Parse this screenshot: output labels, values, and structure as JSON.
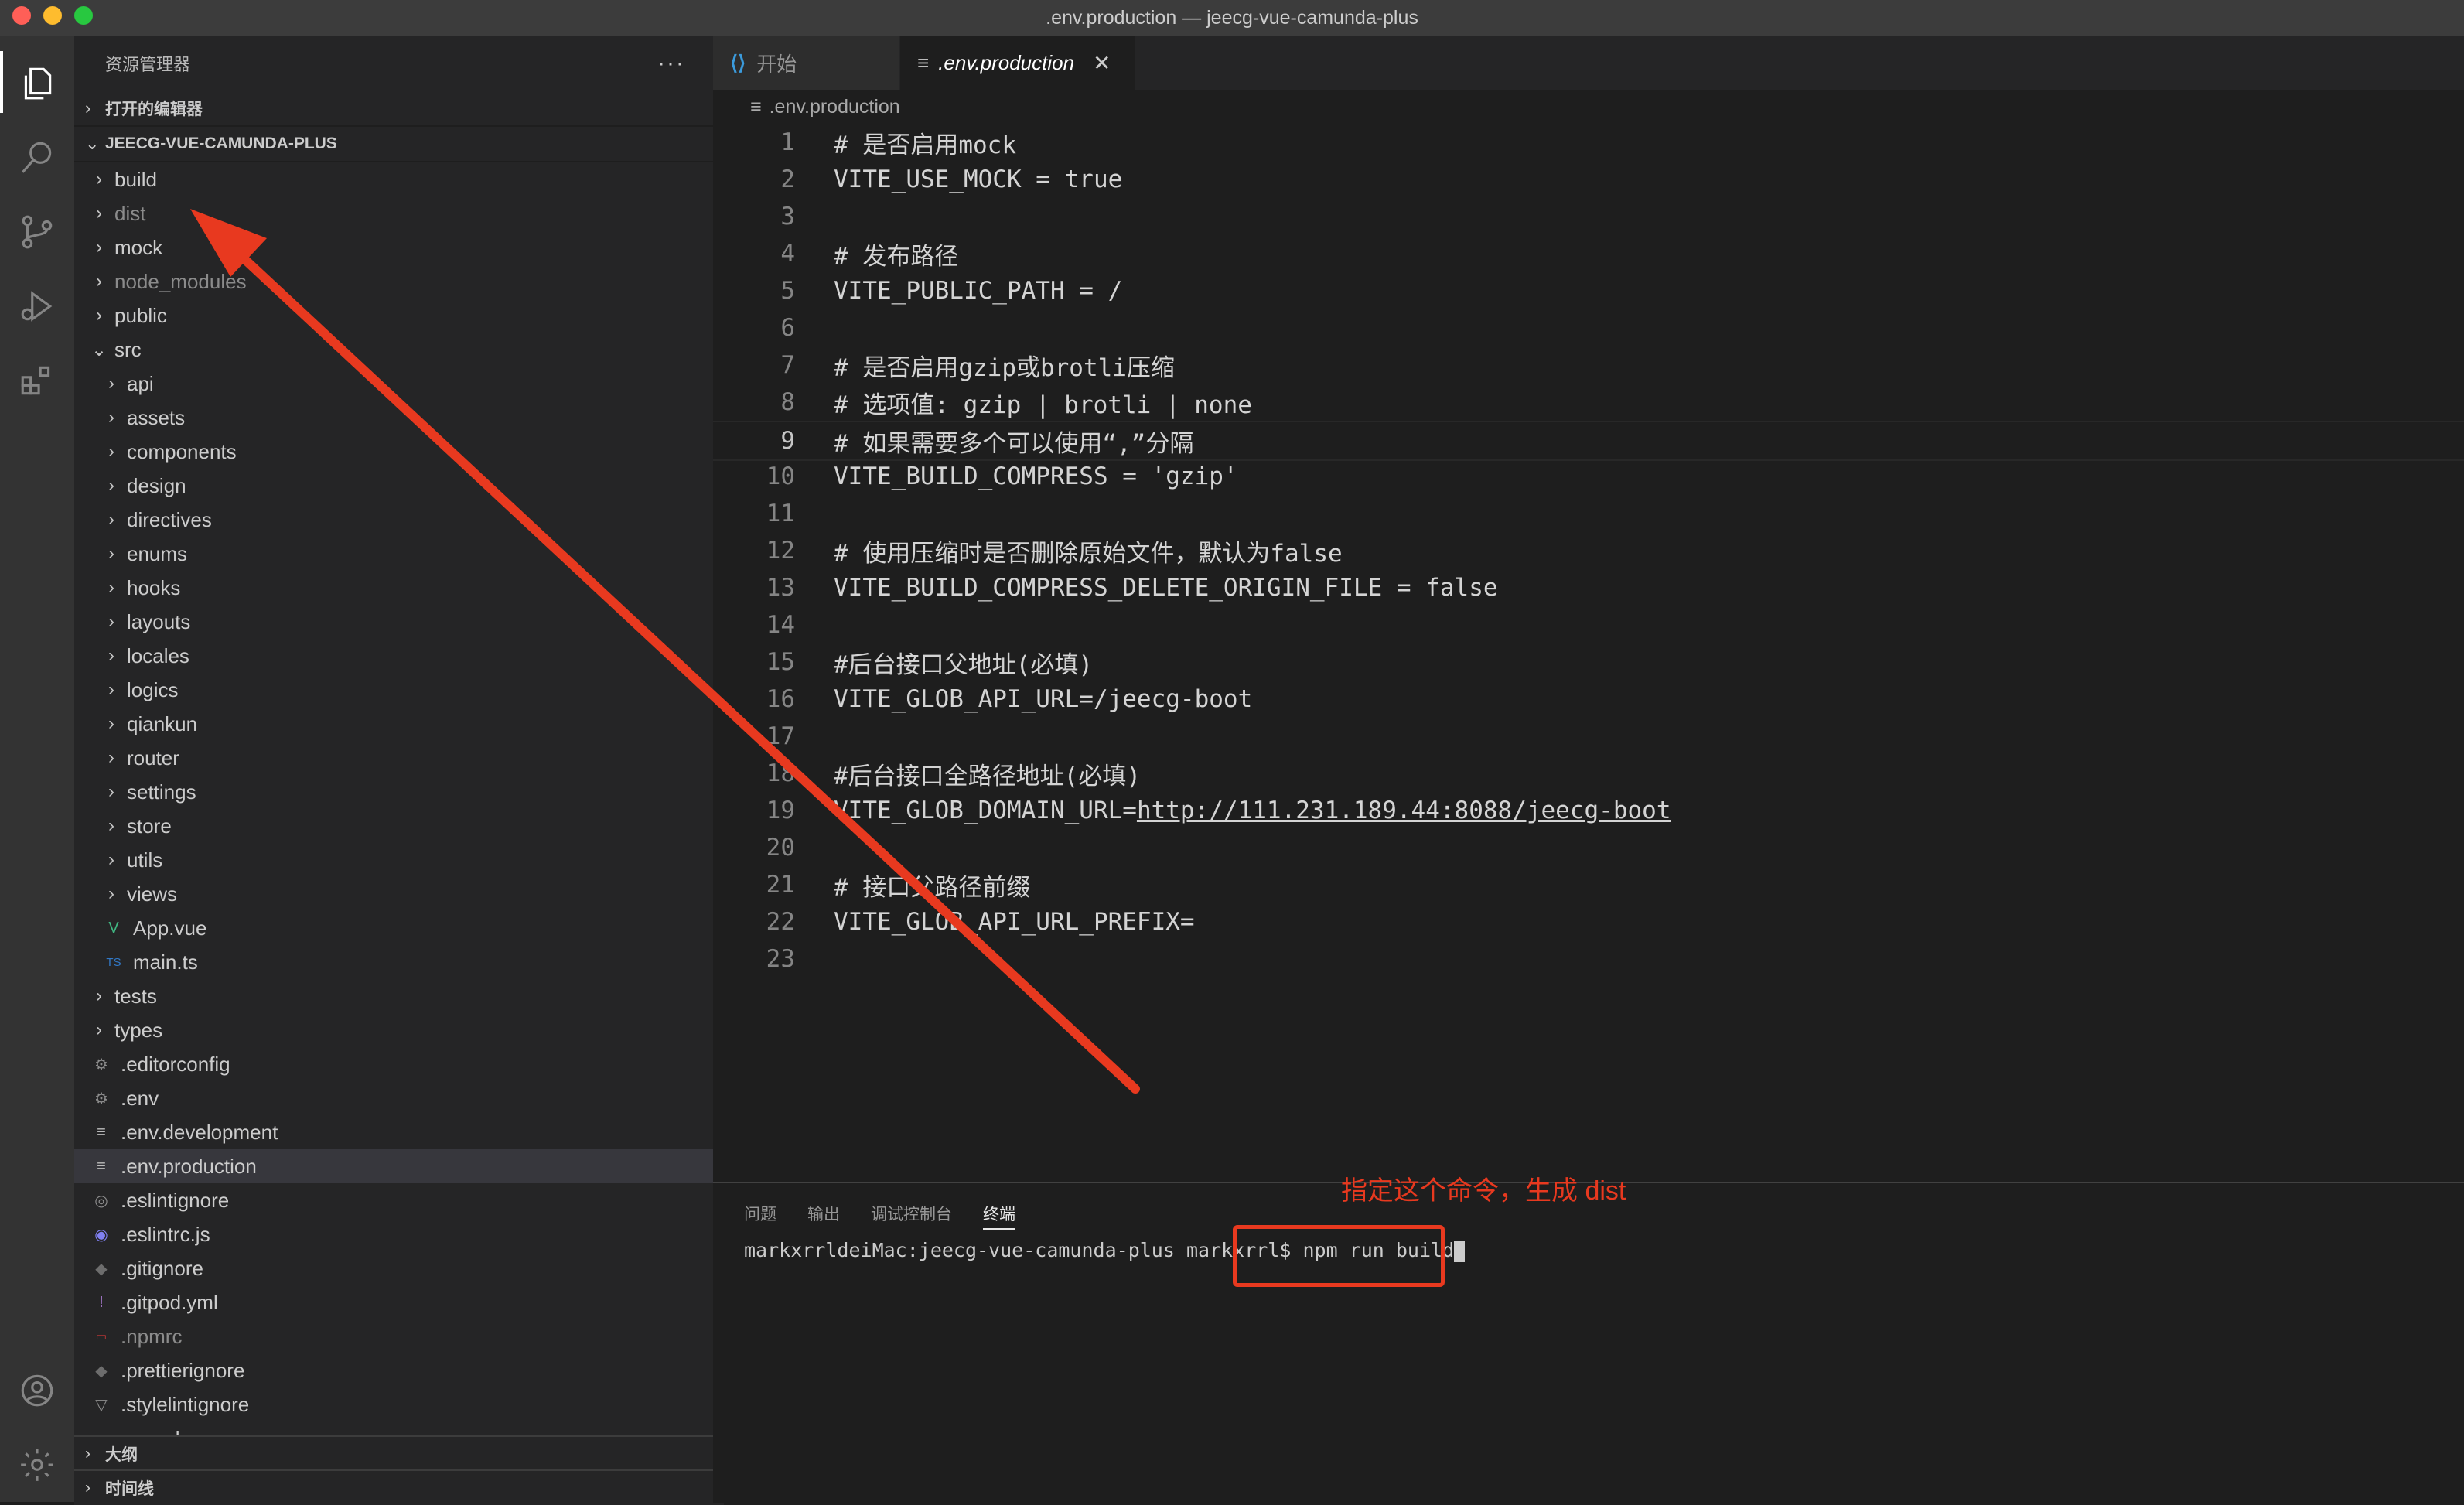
{
  "window": {
    "title": ".env.production — jeecg-vue-camunda-plus"
  },
  "sidebar": {
    "title": "资源管理器",
    "open_editors": "打开的编辑器",
    "project": "JEECG-VUE-CAMUNDA-PLUS",
    "outline": "大纲",
    "timeline": "时间线"
  },
  "explorer": {
    "items": [
      {
        "label": "build",
        "type": "folder",
        "depth": 1
      },
      {
        "label": "dist",
        "type": "folder",
        "depth": 1,
        "dim": true
      },
      {
        "label": "mock",
        "type": "folder",
        "depth": 1
      },
      {
        "label": "node_modules",
        "type": "folder",
        "depth": 1,
        "dim": true
      },
      {
        "label": "public",
        "type": "folder",
        "depth": 1
      },
      {
        "label": "src",
        "type": "folder-open",
        "depth": 1
      },
      {
        "label": "api",
        "type": "folder",
        "depth": 2
      },
      {
        "label": "assets",
        "type": "folder",
        "depth": 2
      },
      {
        "label": "components",
        "type": "folder",
        "depth": 2
      },
      {
        "label": "design",
        "type": "folder",
        "depth": 2
      },
      {
        "label": "directives",
        "type": "folder",
        "depth": 2
      },
      {
        "label": "enums",
        "type": "folder",
        "depth": 2
      },
      {
        "label": "hooks",
        "type": "folder",
        "depth": 2
      },
      {
        "label": "layouts",
        "type": "folder",
        "depth": 2
      },
      {
        "label": "locales",
        "type": "folder",
        "depth": 2
      },
      {
        "label": "logics",
        "type": "folder",
        "depth": 2
      },
      {
        "label": "qiankun",
        "type": "folder",
        "depth": 2
      },
      {
        "label": "router",
        "type": "folder",
        "depth": 2
      },
      {
        "label": "settings",
        "type": "folder",
        "depth": 2
      },
      {
        "label": "store",
        "type": "folder",
        "depth": 2
      },
      {
        "label": "utils",
        "type": "folder",
        "depth": 2
      },
      {
        "label": "views",
        "type": "folder",
        "depth": 2
      },
      {
        "label": "App.vue",
        "type": "vue",
        "depth": 2
      },
      {
        "label": "main.ts",
        "type": "ts",
        "depth": 2
      },
      {
        "label": "tests",
        "type": "folder",
        "depth": 1
      },
      {
        "label": "types",
        "type": "folder",
        "depth": 1
      },
      {
        "label": ".editorconfig",
        "type": "gear",
        "depth": 1
      },
      {
        "label": ".env",
        "type": "gear",
        "depth": 1
      },
      {
        "label": ".env.development",
        "type": "lines",
        "depth": 1
      },
      {
        "label": ".env.production",
        "type": "lines",
        "depth": 1,
        "selected": true
      },
      {
        "label": ".eslintignore",
        "type": "circle",
        "depth": 1
      },
      {
        "label": ".eslintrc.js",
        "type": "eslint",
        "depth": 1
      },
      {
        "label": ".gitignore",
        "type": "diamond",
        "depth": 1
      },
      {
        "label": ".gitpod.yml",
        "type": "bang",
        "depth": 1
      },
      {
        "label": ".npmrc",
        "type": "npm",
        "depth": 1,
        "dim": true
      },
      {
        "label": ".prettierignore",
        "type": "diamond",
        "depth": 1
      },
      {
        "label": ".stylelintignore",
        "type": "triangle",
        "depth": 1
      },
      {
        "label": ".yarnclean",
        "type": "lines",
        "depth": 1
      }
    ]
  },
  "tabs": [
    {
      "label": "开始",
      "icon": "vscode-icon",
      "active": false
    },
    {
      "label": ".env.production",
      "icon": "lines-icon",
      "active": true
    }
  ],
  "breadcrumb": ".env.production",
  "editor": {
    "current_line": 9,
    "lines": [
      "# 是否启用mock",
      "VITE_USE_MOCK = true",
      "",
      "# 发布路径",
      "VITE_PUBLIC_PATH = /",
      "",
      "# 是否启用gzip或brotli压缩",
      "# 选项值: gzip | brotli | none",
      "# 如果需要多个可以使用“,”分隔",
      "VITE_BUILD_COMPRESS = 'gzip'",
      "",
      "# 使用压缩时是否删除原始文件，默认为false",
      "VITE_BUILD_COMPRESS_DELETE_ORIGIN_FILE = false",
      "",
      "#后台接口父地址(必填)",
      "VITE_GLOB_API_URL=/jeecg-boot",
      "",
      "#后台接口全路径地址(必填)",
      "VITE_GLOB_DOMAIN_URL=http://111.231.189.44:8088/jeecg-boot",
      "",
      "# 接口父路径前缀",
      "VITE_GLOB_API_URL_PREFIX=",
      ""
    ],
    "url_prefix": "VITE_GLOB_DOMAIN_URL=",
    "url": "http://111.231.189.44:8088/jeecg-boot"
  },
  "panel": {
    "tabs": [
      "问题",
      "输出",
      "调试控制台",
      "终端"
    ],
    "active_tab": "终端",
    "terminal_prompt": "markxrrldeiMac:jeecg-vue-camunda-plus markxrrl$ ",
    "terminal_command": "npm run build"
  },
  "annotation": {
    "text": "指定这个命令，生成 dist",
    "color": "#e8391f"
  }
}
